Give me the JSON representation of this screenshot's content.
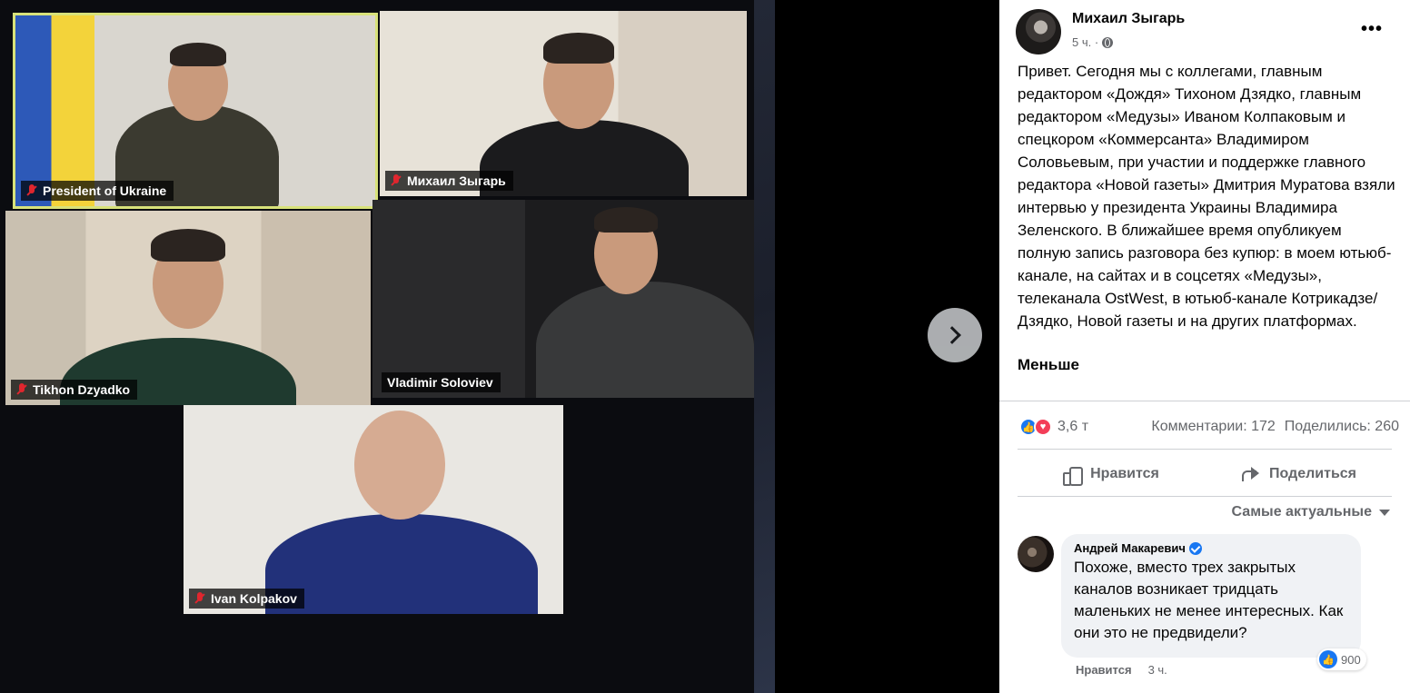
{
  "viewer": {
    "tiles": [
      {
        "name": "President of Ukraine"
      },
      {
        "name": "Михаил Зыгарь"
      },
      {
        "name": "Tikhon Dzyadko"
      },
      {
        "name": "Vladimir Soloviev"
      },
      {
        "name": "Ivan Kolpakov"
      }
    ],
    "next_icon": "chevron-right-icon"
  },
  "post": {
    "author": "Михаил Зыгарь",
    "time": "5 ч. ·",
    "more": "•••",
    "text": "Привет. Сегодня мы с коллегами, главным редактором «Дождя» Тихоном Дзядко, главным редактором «Медузы» Иваном Колпаковым и спецкором «Коммерсанта» Владимиром Соловьевым, при участии и поддержке главного редактора «Новой газеты» Дмитрия Муратова взяли интервью у президента Украины Владимира Зеленского. В ближайшее время опубликуем полную запись разговора без купюр: в моем ютьюб-канале, на сайтах и в соцсетях «Медузы», телеканала OstWest, в ютьюб-канале Котрикадзе/Дзядко, Новой газеты и на других платформах.",
    "less": "Меньше"
  },
  "stats": {
    "reactions": "3,6 т",
    "comments": "Комментарии: 172",
    "shares": "Поделились: 260"
  },
  "actions": {
    "like": "Нравится",
    "share": "Поделиться"
  },
  "sort": {
    "label": "Самые актуальные"
  },
  "comment": {
    "author": "Андрей Макаревич",
    "text": "Похоже, вместо трех закрытых каналов возникает тридцать маленьких не менее интересных. Как они это не предвидели?",
    "reacts": "900",
    "like": "Нравится",
    "time": "3 ч."
  },
  "colors": {
    "accent": "#1877f2",
    "love": "#f33e58",
    "secondary_text": "#65676b",
    "highlight_border": "#d8e27a"
  }
}
